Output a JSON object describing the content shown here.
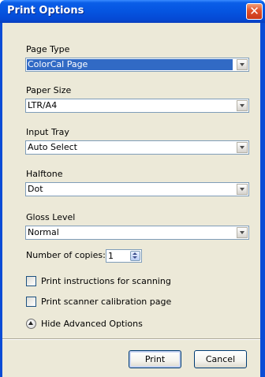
{
  "window": {
    "title": "Print Options",
    "close_label": "✕"
  },
  "fields": {
    "page_type": {
      "label": "Page Type",
      "value": "ColorCal Page"
    },
    "paper_size": {
      "label": "Paper Size",
      "value": "LTR/A4"
    },
    "input_tray": {
      "label": "Input Tray",
      "value": "Auto Select"
    },
    "halftone": {
      "label": "Halftone",
      "value": "Dot"
    },
    "gloss_level": {
      "label": "Gloss Level",
      "value": "Normal"
    }
  },
  "copies": {
    "label": "Number of copies:",
    "value": "1"
  },
  "options": {
    "scan_instructions": {
      "label": "Print instructions for scanning",
      "checked": false
    },
    "calibration_page": {
      "label": "Print scanner calibration page",
      "checked": false
    }
  },
  "advanced": {
    "label": "Hide Advanced Options",
    "icon": "collapse-up-icon"
  },
  "buttons": {
    "print": "Print",
    "cancel": "Cancel"
  },
  "colors": {
    "title_bar": "#0554e0",
    "dialog_bg": "#ece9d8",
    "selection": "#316ac5",
    "input_border": "#7f9db9"
  }
}
